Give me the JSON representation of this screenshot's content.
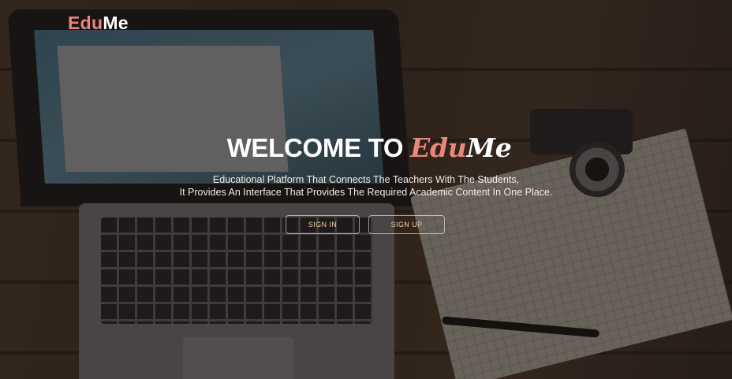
{
  "brand": {
    "logo_prefix": "Edu",
    "logo_suffix": "Me"
  },
  "hero": {
    "headline_prefix": "WELCOME TO ",
    "headline_brand_prefix": "Edu",
    "headline_brand_suffix": "Me",
    "tagline_line1": "Educational Platform That Connects The Teachers With The Students,",
    "tagline_line2": "It Provides An Interface That Provides The Required Academic Content In One Place."
  },
  "actions": {
    "signin_label": "SIGN IN",
    "signup_label": "SIGN UP"
  },
  "colors": {
    "accent": "#e8877a",
    "button_text": "#f4cfa5",
    "overlay": "#16100c"
  }
}
